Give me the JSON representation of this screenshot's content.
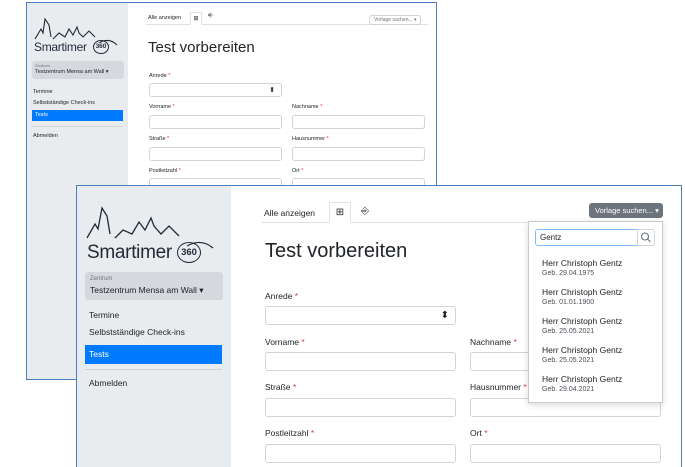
{
  "brand": {
    "name": "Smartimer",
    "badge": "360"
  },
  "sidebar": {
    "center_caption": "Zentrum",
    "center_name": "Testzentrum Mensa am Wall",
    "caret": "▾",
    "items": [
      {
        "label": "Termine",
        "active": false
      },
      {
        "label": "Selbstständige Check-ins",
        "active": false
      },
      {
        "label": "Tests",
        "active": true
      }
    ],
    "logout_label": "Abmelden"
  },
  "tabs": {
    "all_label": "Alle anzeigen",
    "list_icon": "list-add-icon",
    "import_icon": "import-icon"
  },
  "template_button": {
    "label": "Vorlage suchen...",
    "caret": "▾"
  },
  "page": {
    "title": "Test vorbereiten"
  },
  "form": {
    "required_marker": "*",
    "salutation_label": "Anrede",
    "salutation_arrow": "⬍",
    "firstname_label": "Vorname",
    "lastname_label": "Nachname",
    "street_label": "Straße",
    "housenumber_label": "Hausnummer",
    "zip_label": "Postleitzahl",
    "city_label": "Ort"
  },
  "search": {
    "query": "Gentz",
    "results": [
      {
        "name": "Herr Christoph Gentz",
        "dob": "Geb. 29.04.1975"
      },
      {
        "name": "Herr Christoph Gentz",
        "dob": "Geb. 01.01.1900"
      },
      {
        "name": "Herr Christoph Gentz",
        "dob": "Geb. 25.05.2021"
      },
      {
        "name": "Herr Christoph Gentz",
        "dob": "Geb. 25.05.2021"
      },
      {
        "name": "Herr Christoph Gentz",
        "dob": "Geb. 29.04.2021"
      }
    ]
  },
  "colors": {
    "accent": "#007bff",
    "sidebar_bg": "#e9ecef",
    "button_gray": "#6c757d",
    "required": "#dc3545",
    "window_border": "#4a7fc1"
  }
}
